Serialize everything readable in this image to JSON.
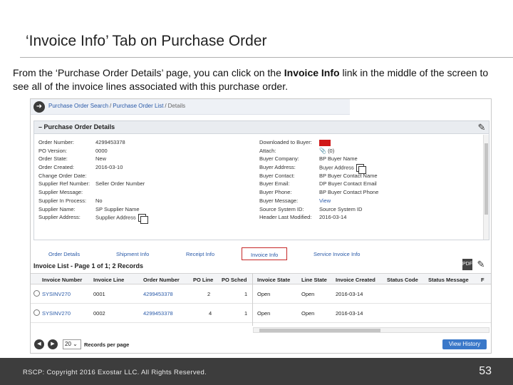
{
  "slide": {
    "title": "‘Invoice Info’ Tab on Purchase Order",
    "intro_pre": "From the ‘Purchase Order Details’ page, you can click on the ",
    "intro_bold": "Invoice Info",
    "intro_post": " link in the middle of the screen to see all of the invoice lines associated with this purchase order.",
    "footer": "RSCP: Copyright 2016 Exostar LLC. All Rights Reserved.",
    "page_number": "53"
  },
  "breadcrumb": {
    "items": [
      "Purchase Order Search",
      "Purchase Order List",
      "Details"
    ],
    "separator": "/"
  },
  "details": {
    "title": "Purchase Order Details",
    "left": [
      {
        "label": "Order Number:",
        "value": "4299453378"
      },
      {
        "label": "PO Version:",
        "value": "0000"
      },
      {
        "label": "Order State:",
        "value": "New"
      },
      {
        "label": "Order Created:",
        "value": "2016-03-10"
      },
      {
        "label": "Change Order Date:",
        "value": ""
      },
      {
        "label": "Supplier Ref Number:",
        "value": "Seller Order Number"
      },
      {
        "label": "Supplier Message:",
        "value": ""
      },
      {
        "label": "Supplier In Process:",
        "value": "No"
      },
      {
        "label": "Supplier Name:",
        "value": "SP Supplier Name"
      },
      {
        "label": "Supplier Address:",
        "value": "Supplier Address"
      }
    ],
    "right": [
      {
        "label": "Downloaded to Buyer:",
        "value": ""
      },
      {
        "label": "Attach:",
        "value": "(0)"
      },
      {
        "label": "Buyer Company:",
        "value": "BP Buyer Name"
      },
      {
        "label": "Buyer Address:",
        "value": "Buyer Address"
      },
      {
        "label": "Buyer Contact:",
        "value": "BP Buyer Contact Name"
      },
      {
        "label": "Buyer Email:",
        "value": "DP Buyer Contact Email"
      },
      {
        "label": "Buyer Phone:",
        "value": "BP Buyer Contact Phone"
      },
      {
        "label": "Buyer Message:",
        "value": "View"
      },
      {
        "label": "Source System ID:",
        "value": "Source System ID"
      },
      {
        "label": "Header Last Modified:",
        "value": "2016-03-14"
      }
    ]
  },
  "tabs": [
    "Order Details",
    "Shipment Info",
    "Receipt Info",
    "Invoice Info",
    "Service Invoice Info"
  ],
  "invoice_list": {
    "title": "Invoice List - Page 1 of 1; 2 Records",
    "columns": [
      "Invoice Number",
      "Invoice Line",
      "Order Number",
      "PO Line",
      "PO Sched",
      "Invoice State",
      "Line State",
      "Invoice Created",
      "Status Code",
      "Status Message",
      "F"
    ],
    "rows": [
      [
        "SYSINV270",
        "0001",
        "4299453378",
        "2",
        "1",
        "Open",
        "Open",
        "2016-03-14"
      ],
      [
        "SYSINV270",
        "0002",
        "4299453378",
        "4",
        "1",
        "Open",
        "Open",
        "2016-03-14"
      ]
    ]
  },
  "pager": {
    "page_size": "20",
    "records_label": "Records per page",
    "history_button": "View History"
  },
  "colors": {
    "link": "#2a5aa8",
    "active_tab_border": "#c62828",
    "downloaded_badge": "#d01818",
    "footer_bg": "#3d3d3d",
    "history_button": "#3a78c9"
  }
}
